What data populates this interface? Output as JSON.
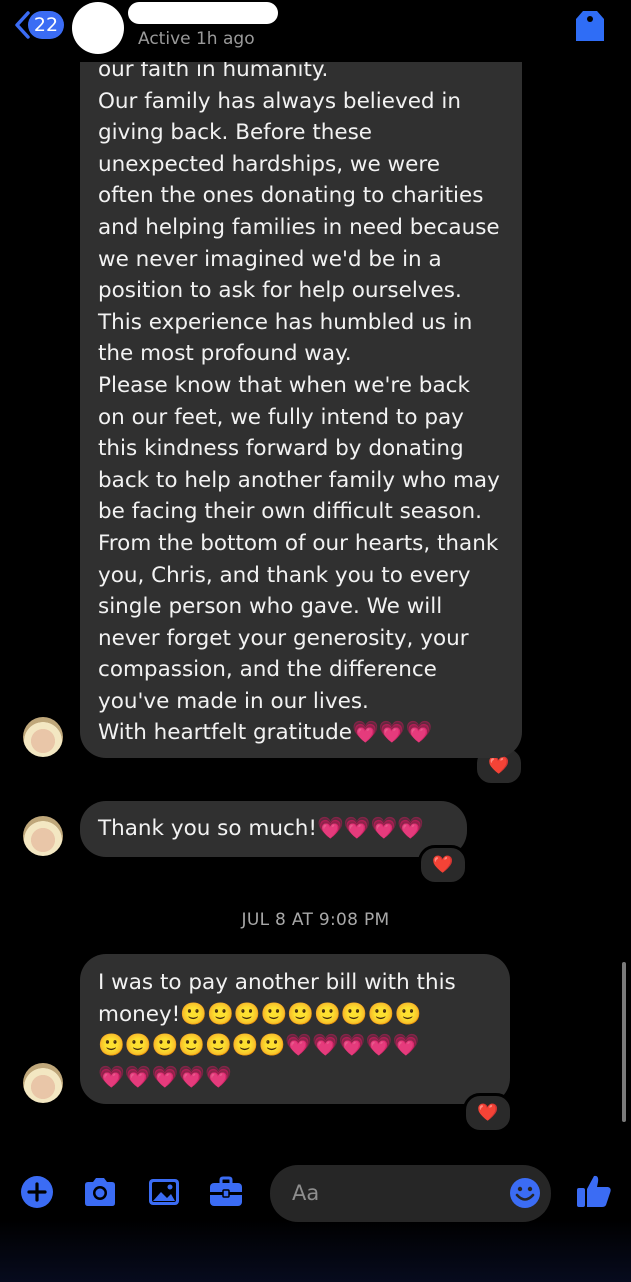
{
  "header": {
    "back_count": "22",
    "status": "Active 1h ago",
    "icons": [
      "back-chevron-icon",
      "tag-icon"
    ]
  },
  "messages": [
    {
      "text": "our faith in humanity.\nOur family has always believed in\ngiving back. Before these\nunexpected hardships, we were\noften the ones donating to charities\nand helping families in need because\nwe never imagined we'd be in a\nposition to ask for help ourselves.\nThis experience has humbled us in\nthe most profound way.\nPlease know that when we're back\non our feet, we fully intend to pay\nthis kindness forward by donating\nback to help another family who may\nbe facing their own difficult season.\nFrom the bottom of our hearts, thank\nyou, Chris, and thank you to every\nsingle person who gave. We will\nnever forget your generosity, your\ncompassion, and the difference\nyou've made in our lives.\nWith heartfelt gratitude💗💗💗",
      "reaction": "❤️"
    },
    {
      "text": "Thank you so much!💗💗💗💗",
      "reaction": "❤️"
    },
    {
      "text": "I was to pay another bill with this\nmoney!🙂🙂🙂🙂🙂🙂🙂🙂🙂\n🙂🙂🙂🙂🙂🙂🙂💗💗💗💗💗\n💗💗💗💗💗",
      "reaction": "❤️"
    }
  ],
  "timestamp": "JUL 8 AT 9:08 PM",
  "composer": {
    "placeholder": "Aa",
    "icons": [
      "plus-icon",
      "camera-icon",
      "photo-icon",
      "briefcase-icon",
      "emoji-icon",
      "thumbs-up-icon"
    ]
  },
  "colors": {
    "accent": "#3b6cf4",
    "bubble": "#303030",
    "background": "#000000"
  }
}
